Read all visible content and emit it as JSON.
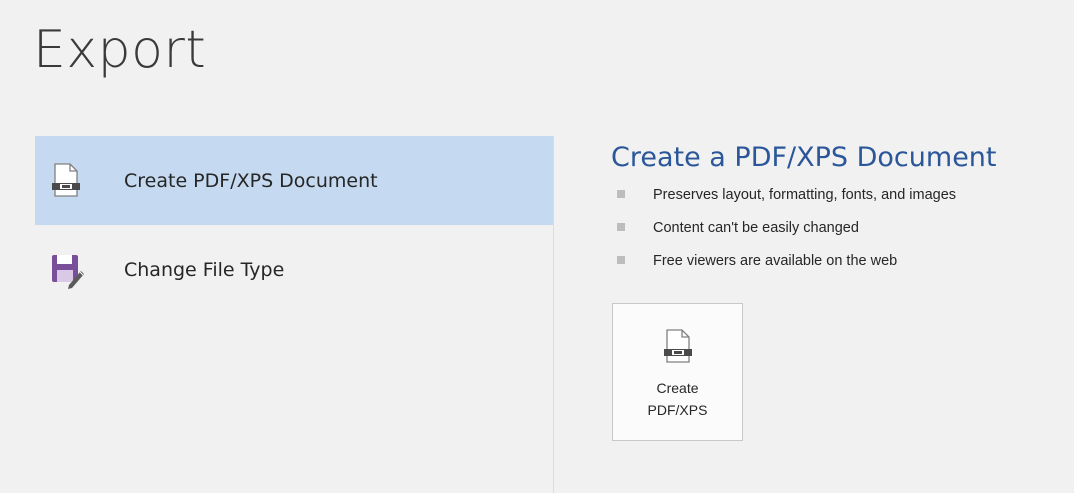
{
  "page": {
    "title": "Export"
  },
  "left_list": {
    "items": [
      {
        "label": "Create PDF/XPS Document",
        "icon": "pdf-document-icon",
        "selected": true
      },
      {
        "label": "Change File Type",
        "icon": "save-as-icon",
        "selected": false
      }
    ]
  },
  "details": {
    "heading": "Create a PDF/XPS Document",
    "bullets": [
      "Preserves layout, formatting, fonts, and images",
      "Content can't be easily changed",
      "Free viewers are available on the web"
    ],
    "button": {
      "line1": "Create",
      "line2": "PDF/XPS",
      "icon": "pdf-document-icon"
    }
  },
  "colors": {
    "background": "#f1f1f1",
    "selected_item": "#c5d9f1",
    "heading_blue": "#2b579a",
    "save_icon_purple": "#7a4f9a"
  }
}
